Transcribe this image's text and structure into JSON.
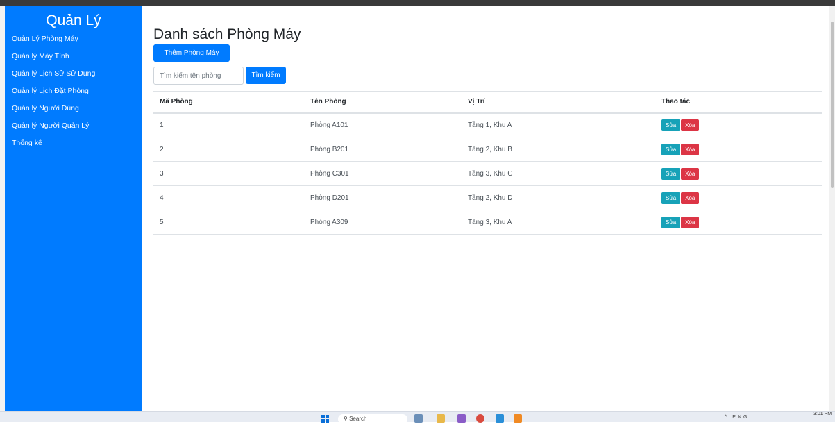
{
  "sidebar": {
    "title": "Quản Lý",
    "items": [
      {
        "label": "Quản Lý Phòng Máy"
      },
      {
        "label": "Quản lý Máy Tính"
      },
      {
        "label": "Quản lý Lịch Sử Sử Dụng"
      },
      {
        "label": "Quản lý Lịch Đặt Phòng"
      },
      {
        "label": "Quản lý Người Dùng"
      },
      {
        "label": "Quản lý Người Quản Lý"
      },
      {
        "label": "Thống kê"
      }
    ]
  },
  "main": {
    "title": "Danh sách Phòng Máy",
    "add_button": "Thêm Phòng Máy",
    "search": {
      "placeholder": "Tìm kiếm tên phòng",
      "button": "Tìm kiếm"
    },
    "table": {
      "headers": [
        "Mã Phòng",
        "Tên Phòng",
        "Vị Trí",
        "Thao tác"
      ],
      "rows": [
        {
          "id": "1",
          "name": "Phòng A101",
          "location": "Tầng 1, Khu A"
        },
        {
          "id": "2",
          "name": "Phòng B201",
          "location": "Tầng 2, Khu B"
        },
        {
          "id": "3",
          "name": "Phòng C301",
          "location": "Tầng 3, Khu C"
        },
        {
          "id": "4",
          "name": "Phòng D201",
          "location": "Tầng 2, Khu D"
        },
        {
          "id": "5",
          "name": "Phòng A309",
          "location": "Tầng 3, Khu A"
        }
      ],
      "edit_label": "Sửa",
      "delete_label": "Xóa"
    }
  },
  "taskbar": {
    "search_label": "Search",
    "time": "3:01 PM",
    "tray_lang": "ENG"
  },
  "colors": {
    "primary": "#007bff",
    "edit": "#17a2b8",
    "delete": "#dc3545"
  }
}
